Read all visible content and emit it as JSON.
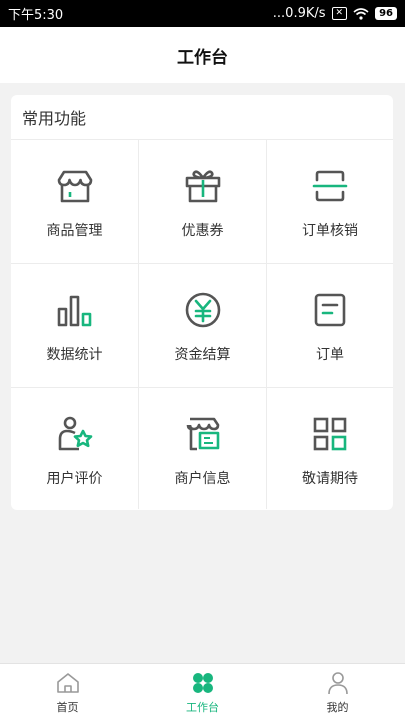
{
  "statusbar": {
    "time": "下午5:30",
    "network": "...0.9K/s",
    "battery": "96"
  },
  "header": {
    "title": "工作台"
  },
  "section": {
    "title": "常用功能"
  },
  "features": [
    {
      "label": "商品管理",
      "icon": "store-icon"
    },
    {
      "label": "优惠券",
      "icon": "gift-icon"
    },
    {
      "label": "订单核销",
      "icon": "scan-icon"
    },
    {
      "label": "数据统计",
      "icon": "bar-chart-icon"
    },
    {
      "label": "资金结算",
      "icon": "yuan-icon"
    },
    {
      "label": "订单",
      "icon": "order-doc-icon"
    },
    {
      "label": "用户评价",
      "icon": "user-star-icon"
    },
    {
      "label": "商户信息",
      "icon": "merchant-info-icon"
    },
    {
      "label": "敬请期待",
      "icon": "grid-icon"
    }
  ],
  "tabs": [
    {
      "label": "首页",
      "icon": "home-icon"
    },
    {
      "label": "工作台",
      "icon": "workbench-icon",
      "active": true
    },
    {
      "label": "我的",
      "icon": "person-icon"
    }
  ],
  "colors": {
    "accent": "#18b67e",
    "icon_gray": "#555555"
  }
}
